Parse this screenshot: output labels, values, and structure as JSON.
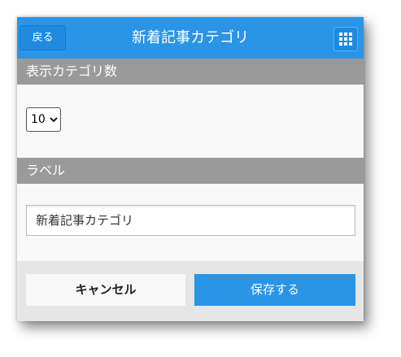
{
  "header": {
    "back_label": "戻る",
    "title": "新着記事カテゴリ",
    "menu_icon": "grid-icon"
  },
  "sections": {
    "count_label": "表示カテゴリ数",
    "label_label": "ラベル"
  },
  "count_select": {
    "value": "10",
    "icon": "chevron-down-icon"
  },
  "label_input": {
    "value": "新着記事カテゴリ"
  },
  "footer": {
    "cancel_label": "キャンセル",
    "save_label": "保存する"
  },
  "colors": {
    "accent": "#2a95e7",
    "section_bar": "#9a9a9a",
    "footer_bg": "#e6e6e6"
  }
}
